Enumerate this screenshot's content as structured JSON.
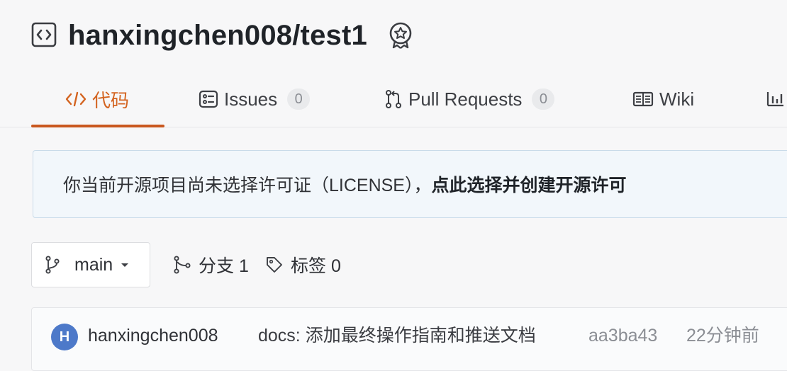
{
  "repo": {
    "title": "hanxingchen008/test1"
  },
  "tabs": [
    {
      "label": "代码",
      "icon": "code-icon",
      "active": true
    },
    {
      "label": "Issues",
      "count": "0",
      "icon": "issues-icon"
    },
    {
      "label": "Pull Requests",
      "count": "0",
      "icon": "pull-request-icon"
    },
    {
      "label": "Wiki",
      "icon": "wiki-icon"
    },
    {
      "label": "",
      "icon": "stats-icon"
    }
  ],
  "license_banner": {
    "text": "你当前开源项目尚未选择许可证（LICENSE），",
    "link": "点此选择并创建开源许可"
  },
  "branch_bar": {
    "branch": "main",
    "branches": "分支 1",
    "tags": "标签 0"
  },
  "commit": {
    "avatar_initial": "H",
    "author": "hanxingchen008",
    "message": "docs: 添加最终操作指南和推送文档",
    "hash": "aa3ba43",
    "time": "22分钟前"
  },
  "colors": {
    "accent": "#c9581f",
    "background": "#f7f7f8",
    "banner_bg": "#f2f7fb",
    "avatar": "#4d79c9"
  }
}
